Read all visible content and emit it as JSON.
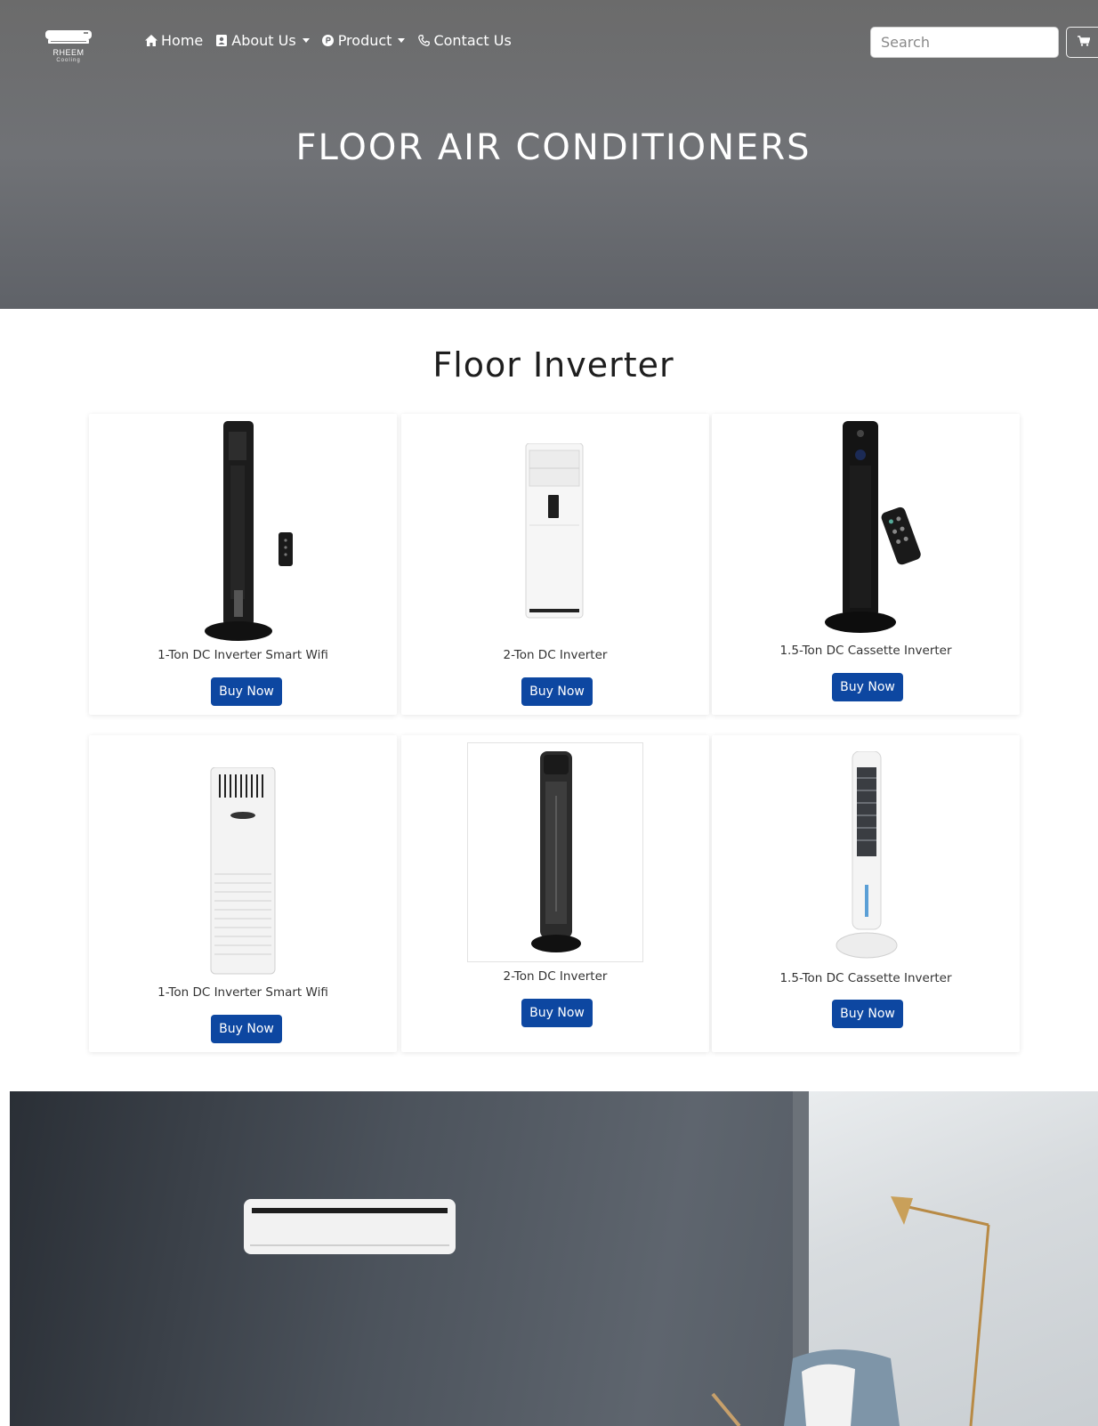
{
  "brand": {
    "name": "RHEEM",
    "tagline": "Cooling"
  },
  "nav": {
    "items": [
      {
        "label": "Home",
        "icon": "home-icon",
        "dropdown": false
      },
      {
        "label": "About Us",
        "icon": "contact-card-icon",
        "dropdown": true
      },
      {
        "label": "Product",
        "icon": "product-circle-icon",
        "dropdown": true
      },
      {
        "label": "Contact Us",
        "icon": "phone-icon",
        "dropdown": false
      }
    ]
  },
  "search": {
    "placeholder": "Search",
    "value": ""
  },
  "cart": {
    "icon": "cart-icon"
  },
  "hero": {
    "title": "FLOOR AIR CONDITIONERS"
  },
  "section": {
    "title": "Floor Inverter"
  },
  "products": [
    {
      "name": "1-Ton DC Inverter Smart Wifi",
      "button": "Buy Now",
      "image": "black-tower-with-remote"
    },
    {
      "name": "2-Ton DC Inverter",
      "button": "Buy Now",
      "image": "white-floor-unit"
    },
    {
      "name": "1.5-Ton DC Cassette Inverter",
      "button": "Buy Now",
      "image": "black-tower-with-remote-2"
    },
    {
      "name": "1-Ton DC Inverter Smart Wifi",
      "button": "Buy Now",
      "image": "white-cabinet-unit"
    },
    {
      "name": "2-Ton DC Inverter",
      "button": "Buy Now",
      "image": "black-heater-tower"
    },
    {
      "name": "1.5-Ton DC Cassette Inverter",
      "button": "Buy Now",
      "image": "white-tower-cooler"
    }
  ],
  "colors": {
    "accent": "#0d47a1",
    "hero": "#6b6d71",
    "text": "#333333"
  }
}
